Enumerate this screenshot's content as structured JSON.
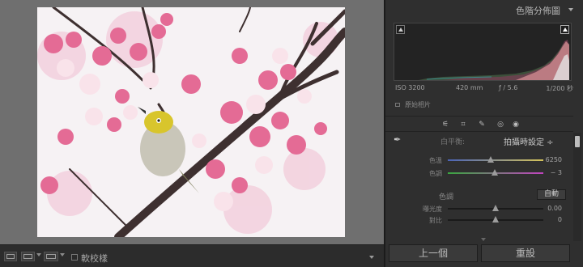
{
  "histogram": {
    "title": "色階分佈圖",
    "exif": {
      "iso": "ISO 3200",
      "focal": "420 mm",
      "aperture": "ƒ / 5.6",
      "shutter": "1/200 秒"
    },
    "original_photo_label": "原始相片"
  },
  "basic": {
    "white_balance_label": "白平衡:",
    "white_balance_value": "拍攝時設定 ÷",
    "sliders": [
      {
        "label": "色溫",
        "value": "6250",
        "level": 0.45
      },
      {
        "label": "色調",
        "value": "− 3",
        "level": 0.49
      },
      {
        "label": "曝光度",
        "value": "0.00",
        "level": 0.5
      },
      {
        "label": "對比",
        "value": "0",
        "level": 0.5
      }
    ],
    "tone_label": "色調",
    "auto_label": "自動"
  },
  "toolbar": {
    "softproof_label": "軟校樣"
  },
  "buttons": {
    "previous_label": "上一個",
    "reset_label": "重設"
  },
  "colors": {
    "panel_bg": "#2f2f2f",
    "viewer_bg": "#6f6f6f",
    "blossom_pink": "#e8719a",
    "branch": "#4a3a3a",
    "bird_yellow": "#d9c42a"
  }
}
